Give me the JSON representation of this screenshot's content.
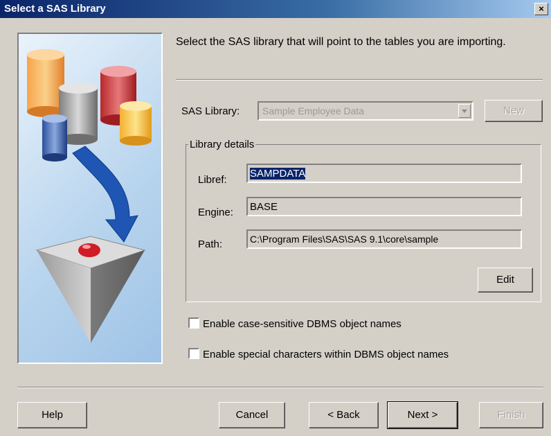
{
  "window": {
    "title": "Select a SAS Library",
    "close_glyph": "×"
  },
  "instructions": "Select the SAS library that will point to the tables you are importing.",
  "library": {
    "label": "SAS Library:",
    "selected": "Sample Employee Data",
    "new_button": "New"
  },
  "details": {
    "title": "Library details",
    "libref_label": "Libref:",
    "libref_value": "SAMPDATA",
    "engine_label": "Engine:",
    "engine_value": "BASE",
    "path_label": "Path:",
    "path_value": "C:\\Program Files\\SAS\\SAS 9.1\\core\\sample",
    "edit_button": "Edit"
  },
  "options": [
    {
      "label": "Enable case-sensitive DBMS object names",
      "checked": false
    },
    {
      "label": "Enable special characters within DBMS object names",
      "checked": false
    }
  ],
  "buttons": {
    "help": "Help",
    "cancel": "Cancel",
    "back": "< Back",
    "next": "Next >",
    "finish": "Finish"
  },
  "colors": {
    "title_bar": "#0a246a",
    "selection": "#0a246a",
    "dialog_bg": "#d4d0c8",
    "arrow": "#1f56b4"
  },
  "icons": [
    "close-icon",
    "dropdown-arrow-icon",
    "database-cylinders-graphic",
    "down-arrow-graphic",
    "pyramid-graphic"
  ]
}
